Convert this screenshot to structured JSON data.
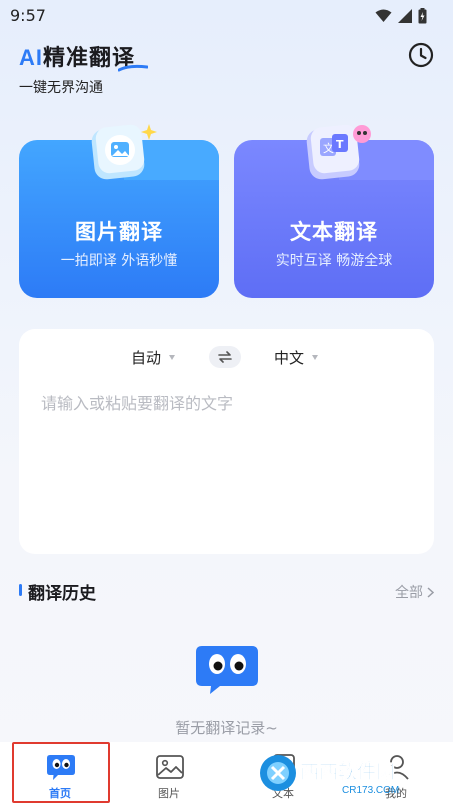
{
  "status_bar": {
    "time": "9:57"
  },
  "header": {
    "title_ai": "AI",
    "title_rest": "精准翻译",
    "subtitle": "一键无界沟通"
  },
  "cards": {
    "image": {
      "title": "图片翻译",
      "subtitle": "一拍即译 外语秒懂"
    },
    "text": {
      "title": "文本翻译",
      "subtitle": "实时互译 畅游全球"
    }
  },
  "translator": {
    "source_lang": "自动",
    "target_lang": "中文",
    "placeholder": "请输入或粘贴要翻译的文字"
  },
  "history": {
    "title": "翻译历史",
    "view_all": "全部",
    "empty_text": "暂无翻译记录~"
  },
  "bottom_nav": {
    "items": [
      {
        "label": "首页",
        "icon": "eyes-chat-icon",
        "active": true
      },
      {
        "label": "图片",
        "icon": "image-icon",
        "active": false
      },
      {
        "label": "文本",
        "icon": "document-icon",
        "active": false
      },
      {
        "label": "我的",
        "icon": "profile-icon",
        "active": false
      }
    ]
  },
  "watermark": {
    "brand": "西西软件园",
    "url": "CR173.COM"
  },
  "colors": {
    "accent": "#2d7bf6",
    "image_card": "#2d7bf6",
    "text_card": "#5e6ef5",
    "highlight_box": "#e03a2f"
  }
}
